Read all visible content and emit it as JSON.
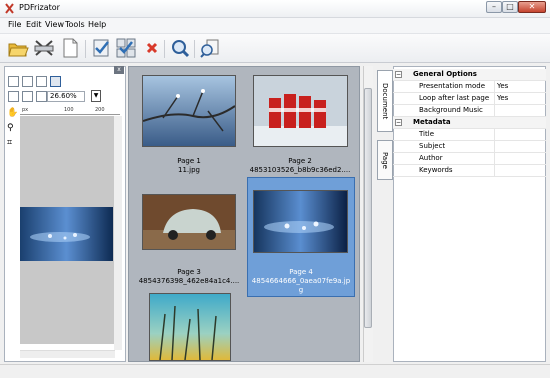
{
  "window": {
    "title": "PDFrizator"
  },
  "menu": [
    "File",
    "Edit",
    "View",
    "Tools",
    "Help"
  ],
  "toolbar": {
    "icons": [
      "open-folder-icon",
      "scanner-icon",
      "blank-page-icon",
      "checked-document-icon",
      "checked-grid-icon",
      "delete-icon",
      "search-zoom-icon",
      "export-icon"
    ]
  },
  "left_panel": {
    "zoom": "26.60%",
    "ruler_unit": "px",
    "ruler_ticks": [
      "100",
      "200"
    ]
  },
  "thumbnails": [
    {
      "line1": "Page 1",
      "line2": "11.jpg",
      "line3": "",
      "selected": false
    },
    {
      "line1": "Page 2",
      "line2": "4853103526_b8b9c36ed2....",
      "line3": "",
      "selected": false
    },
    {
      "line1": "Page 3",
      "line2": "4854376398_462e84a1c4....",
      "line3": "",
      "selected": false
    },
    {
      "line1": "Page 4",
      "line2": "4854664666_0aea07fe9a.jp",
      "line3": "g",
      "selected": true
    }
  ],
  "right_tabs": [
    "Document",
    "Page"
  ],
  "properties": {
    "general_title": "General Options",
    "presentation_mode_label": "Presentation mode",
    "presentation_mode_value": "Yes",
    "loop_label": "Loop after last page",
    "loop_value": "Yes",
    "music_label": "Background Music",
    "metadata_title": "Metadata",
    "title_label": "Title",
    "subject_label": "Subject",
    "author_label": "Author",
    "keywords_label": "Keywords"
  },
  "colors": {
    "selection": "#6f9fd8",
    "thumb_bg": "#b0b6be",
    "delete": "#d93a2b"
  }
}
